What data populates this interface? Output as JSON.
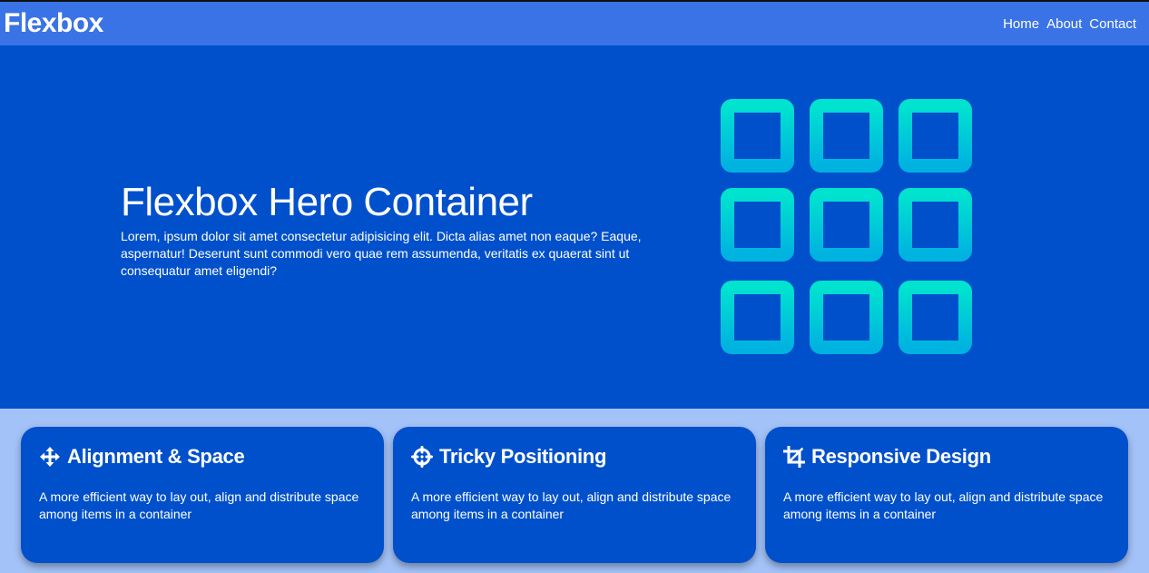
{
  "header": {
    "brand": "Flexbox",
    "nav": [
      {
        "label": "Home"
      },
      {
        "label": "About"
      },
      {
        "label": "Contact"
      }
    ]
  },
  "hero": {
    "title": "Flexbox Hero Container",
    "text": "Lorem, ipsum dolor sit amet consectetur adipisicing elit. Dicta alias amet non eaque? Eaque, aspernatur! Deserunt sunt commodi vero quae rem assumenda, veritatis ex quaerat sint ut consequatur amet eligendi?",
    "icon": "grid-icon"
  },
  "features": [
    {
      "icon": "arrows-move-icon",
      "title": "Alignment & Space",
      "text": "A more efficient way to lay out, align and distribute space among items in a container"
    },
    {
      "icon": "crosshair-icon",
      "title": "Tricky Positioning",
      "text": "A more efficient way to lay out, align and distribute space among items in a container"
    },
    {
      "icon": "crop-icon",
      "title": "Responsive Design",
      "text": "A more efficient way to lay out, align and distribute space among items in a container"
    }
  ],
  "colors": {
    "header": "#3a73e6",
    "hero": "#0050cc",
    "features_bg": "#a3c2f7",
    "card": "#0050cc",
    "grid_gradient_top": "#00e3cf",
    "grid_gradient_bottom": "#00b2e0"
  }
}
